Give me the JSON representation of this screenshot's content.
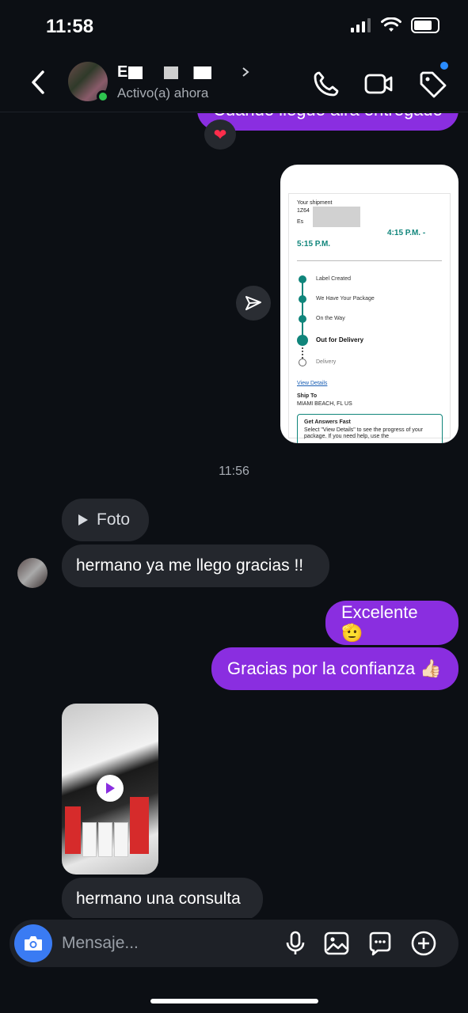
{
  "status_bar": {
    "time": "11:58"
  },
  "header": {
    "contact_name": "E",
    "presence": "Activo(a) ahora"
  },
  "messages": {
    "partial_out": "Cuando llegue aira entregado",
    "shared_screenshot": {
      "your_shipment": "Your shipment",
      "tracking": "1Z64",
      "est": "Es",
      "time_a": "4:15 P.M. -",
      "time_b": "5:15 P.M.",
      "steps": [
        "Label Created",
        "We Have Your Package",
        "On the Way",
        "Out for Delivery",
        "Delivery"
      ],
      "view_details": "View Details",
      "ship_to_label": "Ship To",
      "ship_to_value": "MIAMI BEACH, FL US",
      "faq_title": "Get Answers Fast",
      "faq_body": "Select \"View Details\" to see the progress of your package. If you need help, use the"
    },
    "timestamp": "11:56",
    "foto_label": "Foto",
    "in_1": "hermano ya me llego gracias !!",
    "out_1": "Excelente 🫡",
    "out_2": "Gracias por la confianza 👍🏻",
    "in_2": "hermano una consulta"
  },
  "composer": {
    "placeholder": "Mensaje..."
  }
}
